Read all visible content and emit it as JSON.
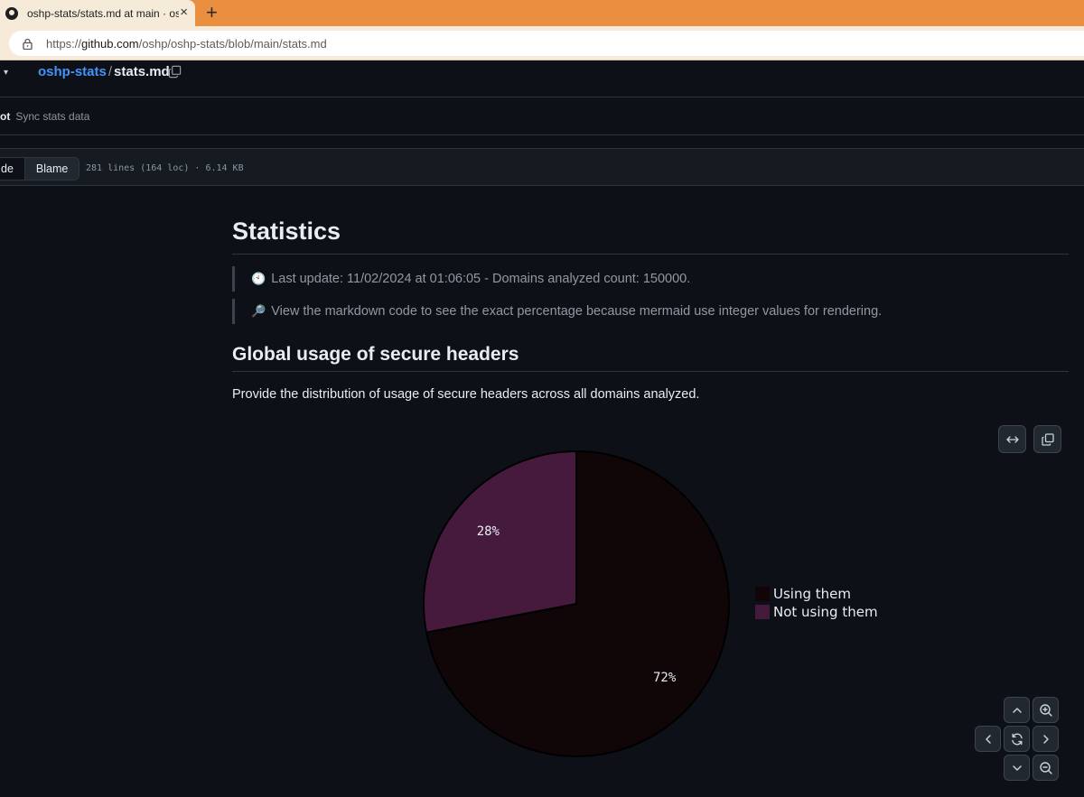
{
  "browser": {
    "tab_title": "oshp-stats/stats.md at main · oshp",
    "tab_close": "×",
    "new_tab": "+",
    "url_prefix": "https://",
    "url_host": "github.com",
    "url_path": "/oshp/oshp-stats/blob/main/stats.md"
  },
  "repo": {
    "caret": "▾",
    "name": "oshp-stats",
    "sep": "/",
    "file": "stats.md"
  },
  "commit": {
    "author": "ot",
    "message": "Sync stats data"
  },
  "filebar": {
    "code_label": "de",
    "blame_label": "Blame",
    "info": "281 lines (164 loc) · 6.14 KB"
  },
  "doc": {
    "title": "Statistics",
    "quote1_icon": "🕙",
    "quote1": "Last update: 11/02/2024 at 01:06:05 - Domains analyzed count: 150000.",
    "quote2_icon": "🔎",
    "quote2": "View the markdown code to see the exact percentage because mermaid use integer values for rendering.",
    "section_title": "Global usage of secure headers",
    "section_desc": "Provide the distribution of usage of secure headers across all domains analyzed."
  },
  "icons": {
    "expand": "expand-horizontal-icon",
    "copy": "copy-icon",
    "up": "chevron-up-icon",
    "down": "chevron-down-icon",
    "left": "chevron-left-icon",
    "right": "chevron-right-icon",
    "reset": "reset-icon",
    "zoom_in": "zoom-in-icon",
    "zoom_out": "zoom-out-icon"
  },
  "chart_data": {
    "type": "pie",
    "labels": [
      "Using them",
      "Not using them"
    ],
    "values": [
      72,
      28
    ],
    "value_labels": [
      "72%",
      "28%"
    ],
    "colors": [
      "#100507",
      "#461a3d"
    ],
    "legend_position": "right"
  }
}
